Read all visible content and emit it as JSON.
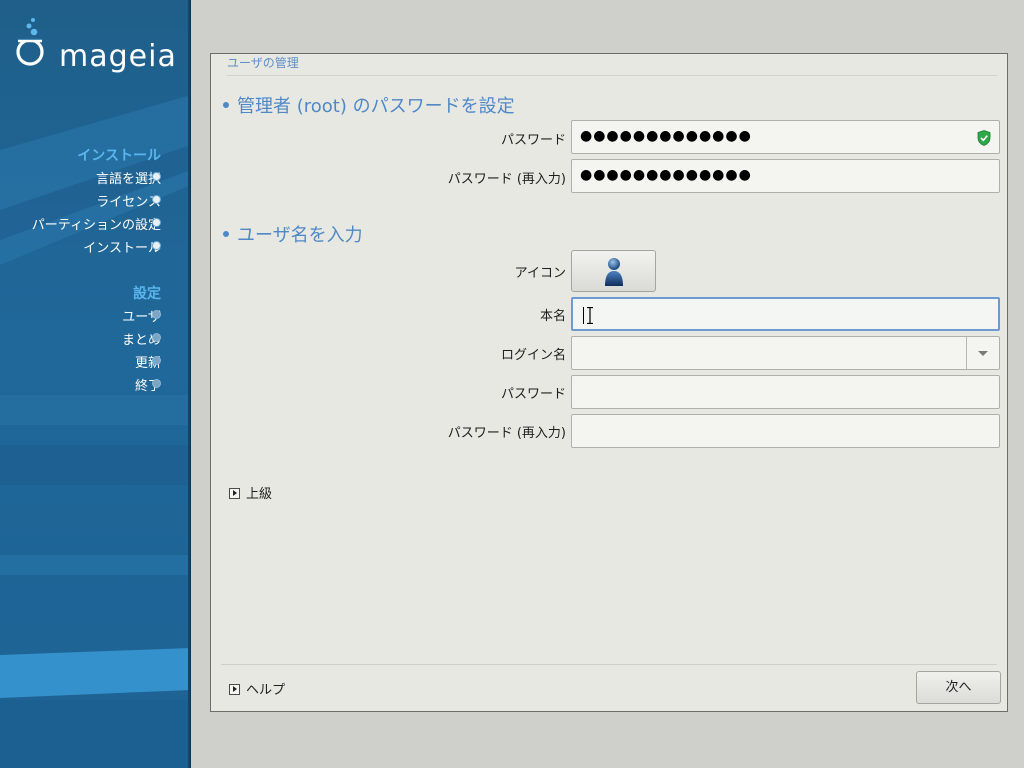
{
  "brand": {
    "logo_text": "mageia",
    "accent": "#4f88c6",
    "sidebar_bg": "#20689a"
  },
  "sidebar": {
    "groups": [
      {
        "title": "インストール",
        "items": [
          {
            "label": "言語を選択",
            "done": true
          },
          {
            "label": "ライセンス",
            "done": true
          },
          {
            "label": "パーティションの設定",
            "done": true
          },
          {
            "label": "インストール",
            "done": true
          }
        ]
      },
      {
        "title": "設定",
        "items": [
          {
            "label": "ユーザ",
            "done": false
          },
          {
            "label": "まとめ",
            "done": false
          },
          {
            "label": "更新",
            "done": false
          },
          {
            "label": "終了",
            "done": false
          }
        ]
      }
    ]
  },
  "dialog": {
    "title": "ユーザの管理",
    "root_section": {
      "heading": "管理者 (root) のパスワードを設定",
      "password_label": "パスワード",
      "password_value": "●●●●●●●●●●●●●",
      "password_confirm_label": "パスワード (再入力)",
      "password_confirm_value": "●●●●●●●●●●●●●",
      "strength_icon": "shield-check-icon"
    },
    "user_section": {
      "heading": "ユーザ名を入力",
      "icon_label": "アイコン",
      "icon_name": "user-avatar-icon",
      "realname_label": "本名",
      "realname_value": "",
      "login_label": "ログイン名",
      "login_value": "",
      "password_label": "パスワード",
      "password_value": "",
      "password_confirm_label": "パスワード (再入力)",
      "password_confirm_value": ""
    },
    "advanced_label": "上級",
    "help_label": "ヘルプ",
    "next_label": "次へ"
  }
}
